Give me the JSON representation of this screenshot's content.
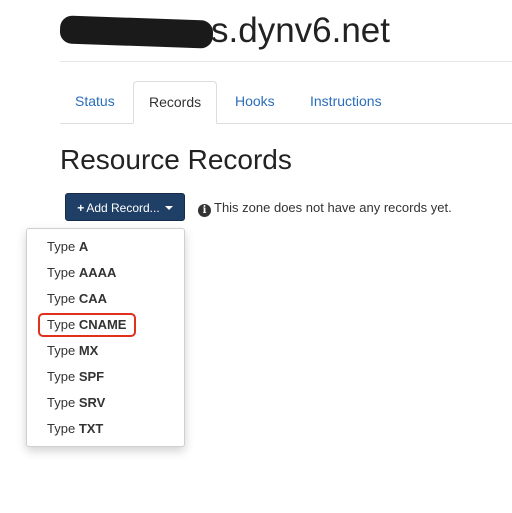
{
  "header": {
    "zone_title_suffix": "s.dynv6.net"
  },
  "tabs": [
    {
      "label": "Status"
    },
    {
      "label": "Records"
    },
    {
      "label": "Hooks"
    },
    {
      "label": "Instructions"
    }
  ],
  "section": {
    "title": "Resource Records"
  },
  "add_button": {
    "label": "Add Record..."
  },
  "info": {
    "text": "This zone does not have any records yet."
  },
  "dropdown": {
    "prefix": "Type",
    "items": [
      {
        "type": "A"
      },
      {
        "type": "AAAA"
      },
      {
        "type": "CAA"
      },
      {
        "type": "CNAME"
      },
      {
        "type": "MX"
      },
      {
        "type": "SPF"
      },
      {
        "type": "SRV"
      },
      {
        "type": "TXT"
      }
    ],
    "highlighted": "CNAME"
  },
  "colors": {
    "link": "#2a6ebb",
    "button_bg": "#1f3f66",
    "highlight": "#e0301e"
  }
}
